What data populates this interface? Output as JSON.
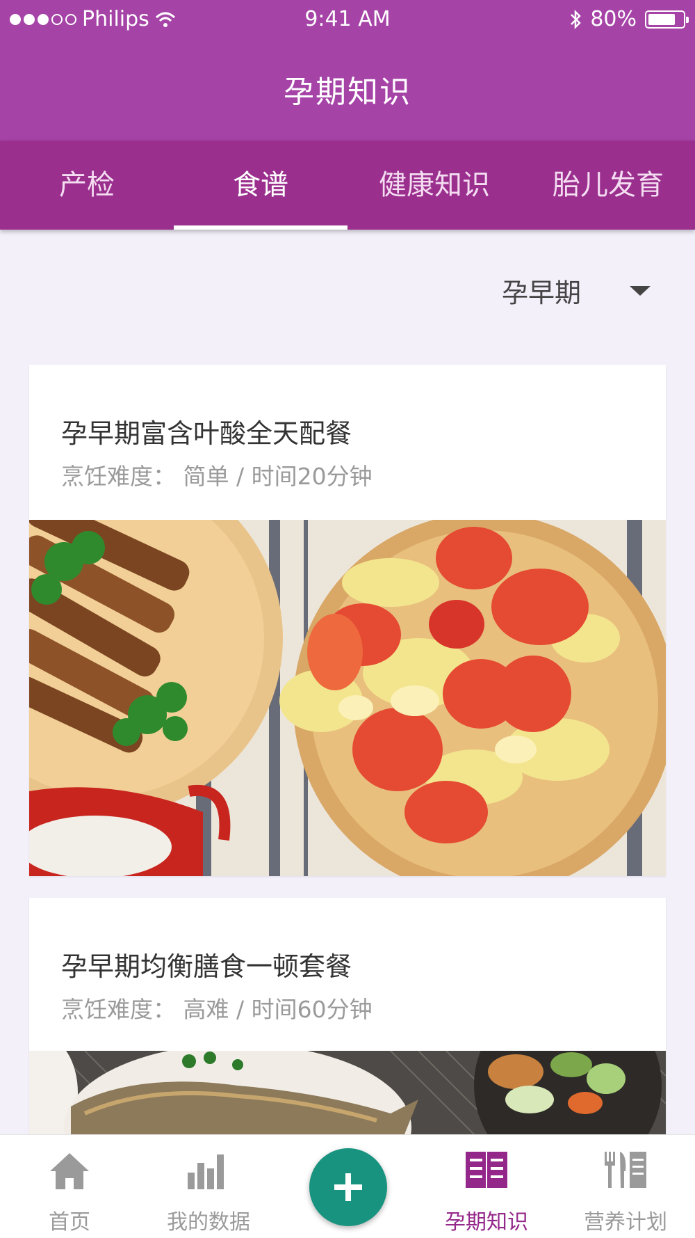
{
  "status_bar": {
    "carrier": "Philips",
    "time": "9:41 AM",
    "battery": "80%",
    "battery_level": 0.8
  },
  "header": {
    "title": "孕期知识"
  },
  "tabs": [
    {
      "label": "产检"
    },
    {
      "label": "食谱"
    },
    {
      "label": "健康知识"
    },
    {
      "label": "胎儿发育"
    }
  ],
  "active_tab": "食谱",
  "filter": {
    "selected": "孕早期"
  },
  "recipes": [
    {
      "title": "孕早期富含叶酸全天配餐",
      "meta": "烹饪难度： 简单 / 时间20分钟"
    },
    {
      "title": "孕早期均衡膳食一顿套餐",
      "meta": "烹饪难度： 高难 / 时间60分钟"
    }
  ],
  "bottom_nav": [
    {
      "label": "首页",
      "icon": "home-icon"
    },
    {
      "label": "我的数据",
      "icon": "bar-chart-icon"
    },
    {
      "label": "孕期知识",
      "icon": "knowledge-book-icon"
    },
    {
      "label": "营养计划",
      "icon": "utensils-icon"
    }
  ],
  "active_nav": "孕期知识",
  "fab": {
    "icon": "plus-icon"
  },
  "colors": {
    "primary": "#a643a7",
    "tab_bar": "#9a2f8e",
    "accent": "#17937f",
    "active_nav": "#94278a",
    "background": "#f3f0fa"
  }
}
